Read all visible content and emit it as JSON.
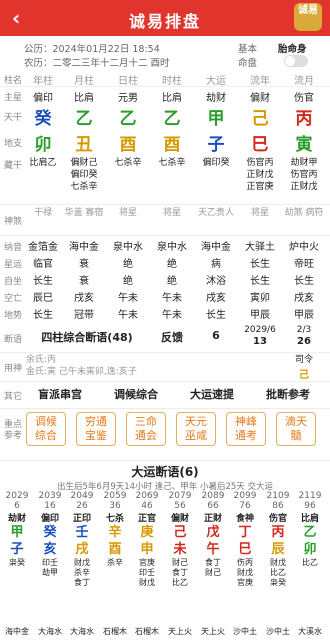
{
  "header": {
    "back": "‹",
    "title": "诚易排盘",
    "logo": "诚易"
  },
  "info": {
    "gongli": "公历：2024年01月22日 18:54",
    "nongli": "农历：二零二三年十二月十二 酉时",
    "jiben": "基本",
    "mingpan": "命盘",
    "taimian": "胎命身"
  },
  "labels": {
    "zhuzhu": "柱名",
    "zhuxing": "主星",
    "tiangan": "天干",
    "dizhi": "地支",
    "canggan": "藏干",
    "fuxing": "副星",
    "shensha": "神煞",
    "nayin": "纳音",
    "xingyun": "星运",
    "zizuo": "自坐",
    "kongwang": "空亡",
    "dishi": "地势",
    "duanyu": "断语",
    "yongshen": "用神",
    "qita": "其它",
    "zhongdian": "重点参考"
  },
  "columns": [
    "年柱",
    "月柱",
    "日柱",
    "时柱",
    "大运",
    "流年",
    "流月"
  ],
  "zhuxing": [
    "偏印",
    "比肩",
    "元男",
    "比肩",
    "劫财",
    "偏财",
    "伤官"
  ],
  "tiangan": [
    "癸",
    "乙",
    "乙",
    "乙",
    "甲",
    "己",
    "丙"
  ],
  "tiangan_colors": [
    "blue",
    "green",
    "green",
    "green",
    "green",
    "yellow",
    "red"
  ],
  "dizhi": [
    "卯",
    "丑",
    "酉",
    "酉",
    "子",
    "巳",
    "寅"
  ],
  "dizhi_colors": [
    "green",
    "yellow",
    "yellow",
    "yellow",
    "blue",
    "red",
    "green"
  ],
  "canggan": [
    [
      "比肩乙"
    ],
    [
      "偏财己",
      "偏印癸",
      "七杀辛"
    ],
    [
      "七杀辛"
    ],
    [
      "七杀辛"
    ],
    [
      "偏印癸"
    ],
    [
      "伤官丙",
      "正财戊",
      "正官庚"
    ],
    [
      "劫财甲",
      "伤官丙",
      "正财戊"
    ]
  ],
  "shensha": [
    "干禄",
    "华盖 寡宿",
    "将星",
    "将星",
    "天乙贵人",
    "将星",
    "劫煞 病符"
  ],
  "nayin": [
    "金箔金",
    "海中金",
    "泉中水",
    "泉中水",
    "海中金",
    "大驿土",
    "炉中火"
  ],
  "xingyun": [
    "临官",
    "衰",
    "绝",
    "绝",
    "病",
    "长生",
    "帝旺"
  ],
  "zizuo": [
    "长生",
    "衰",
    "绝",
    "绝",
    "沐浴",
    "长生",
    "长生"
  ],
  "kongwang": [
    "辰巳",
    "戌亥",
    "午未",
    "午未",
    "戌亥",
    "寅卯",
    "戌亥"
  ],
  "dishi": [
    "长生",
    "冠带",
    "午未",
    "午未",
    "长生",
    "甲辰",
    "甲辰"
  ],
  "duanyu": {
    "main": "四柱综合断语(48)",
    "fanying": "反馈",
    "num": "6",
    "date": "2029/6",
    "date2": "13",
    "month": "2/3",
    "month2": "26"
  },
  "yongshen": {
    "line1": "余氏:丙",
    "line2": "金氏:寅 己午未寅卯,逸:亥子",
    "siling": "司令",
    "siling_val": "己"
  },
  "qita_buttons": [
    "盲派串宫",
    "调候综合",
    "大运速提",
    "批断参考"
  ],
  "tiles": [
    [
      "调候",
      "综合"
    ],
    [
      "穷通",
      "宝鉴"
    ],
    [
      "三命",
      "通会"
    ],
    [
      "天元",
      "巫咸"
    ],
    [
      "神峰",
      "通考"
    ],
    [
      "滴天",
      "髓"
    ]
  ],
  "dayun": {
    "title": "大运断语(6)",
    "sub": "出生后5年6月9天14小时 逢己、甲年 小暑后25天 交大运",
    "years": [
      "2029",
      "2039",
      "2049",
      "2059",
      "2069",
      "2079",
      "2089",
      "2099",
      "2109",
      "2119"
    ],
    "ages": [
      "6",
      "16",
      "26",
      "36",
      "46",
      "56",
      "66",
      "76",
      "86",
      "96"
    ],
    "shishen": [
      "劫财",
      "偏印",
      "正印",
      "七杀",
      "正官",
      "偏财",
      "正财",
      "食神",
      "伤官",
      "比肩"
    ],
    "tiangan": [
      "甲",
      "癸",
      "壬",
      "辛",
      "庚",
      "己",
      "戊",
      "丁",
      "丙",
      "乙"
    ],
    "tiangan_colors": [
      "green",
      "blue",
      "blue",
      "yellow",
      "yellow",
      "red",
      "red",
      "red",
      "red",
      "green"
    ],
    "dizhi": [
      "子",
      "亥",
      "戌",
      "酉",
      "申",
      "未",
      "午",
      "巳",
      "辰",
      "卯"
    ],
    "dizhi_colors": [
      "blue",
      "blue",
      "yellow",
      "yellow",
      "yellow",
      "red",
      "red",
      "red",
      "yellow",
      "green"
    ],
    "canggan": [
      [
        "枭癸"
      ],
      [
        "印壬",
        "劫甲"
      ],
      [
        "财戊",
        "杀辛",
        "食丁"
      ],
      [
        "杀辛"
      ],
      [
        "官庚",
        "印壬",
        "财戊"
      ],
      [
        "财己",
        "食丁",
        "比乙"
      ],
      [
        "食丁",
        "财己"
      ],
      [
        "伤丙",
        "财戊",
        "官庚"
      ],
      [
        "财戊",
        "比乙",
        "枭癸"
      ],
      [
        "比乙"
      ]
    ],
    "nayin": [
      "海中金",
      "大海水",
      "大海水",
      "石榴木",
      "石榴木",
      "天上火",
      "天上火",
      "沙中土",
      "沙中土",
      "大溪水"
    ]
  }
}
